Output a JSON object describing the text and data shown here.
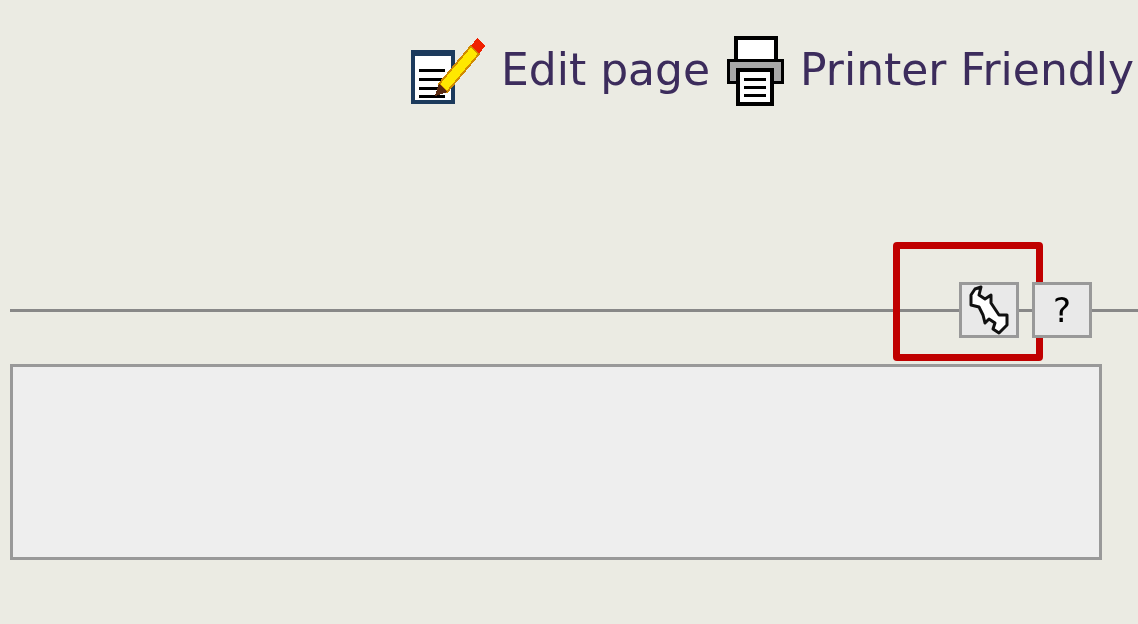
{
  "page_actions": [
    {
      "kind": "edit",
      "label": "Edit page"
    },
    {
      "kind": "print",
      "label": "Printer Friendly"
    }
  ],
  "toolbar_buttons": [
    {
      "kind": "wrench",
      "highlighted": true
    },
    {
      "kind": "help",
      "label": "?",
      "highlighted": false
    }
  ]
}
